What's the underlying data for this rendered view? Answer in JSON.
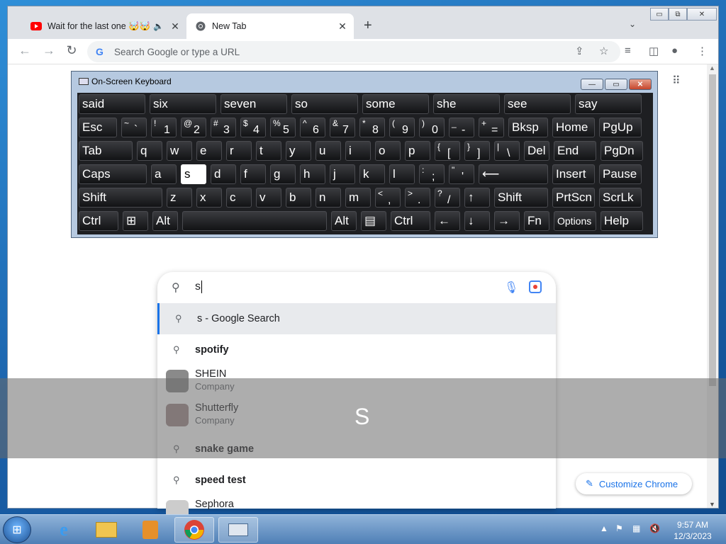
{
  "browser": {
    "tabs": [
      {
        "label": "Wait for the last one 🤯🤯 #sh",
        "icon": "youtube-icon",
        "audio": "🔈"
      },
      {
        "label": "New Tab",
        "icon": "chrome-icon"
      }
    ],
    "close_glyph": "✕",
    "new_tab_glyph": "+",
    "tab_search_glyph": "⌄",
    "window_controls": [
      "▭",
      "⧉",
      "✕"
    ],
    "omnibox_placeholder": "Search Google or type a URL",
    "google_letter": "G"
  },
  "osk": {
    "title": "On-Screen Keyboard",
    "controls": [
      "—",
      "▭",
      "✕"
    ],
    "pressed_key": "s",
    "rows": [
      [
        {
          "t": "said",
          "w": 96
        },
        {
          "t": "six",
          "w": 96
        },
        {
          "t": "seven",
          "w": 96
        },
        {
          "t": "so",
          "w": 96
        },
        {
          "t": "some",
          "w": 96
        },
        {
          "t": "she",
          "w": 96
        },
        {
          "t": "see",
          "w": 96
        },
        {
          "t": "say",
          "w": 96
        }
      ],
      [
        {
          "t": "Esc",
          "w": 56
        },
        {
          "sup": "~",
          "m": "`",
          "w": 38
        },
        {
          "sup": "!",
          "m": "1",
          "w": 38
        },
        {
          "sup": "@",
          "m": "2",
          "w": 38
        },
        {
          "sup": "#",
          "m": "3",
          "w": 38
        },
        {
          "sup": "$",
          "m": "4",
          "w": 38
        },
        {
          "sup": "%",
          "m": "5",
          "w": 38
        },
        {
          "sup": "^",
          "m": "6",
          "w": 38
        },
        {
          "sup": "&",
          "m": "7",
          "w": 38
        },
        {
          "sup": "*",
          "m": "8",
          "w": 38
        },
        {
          "sup": "(",
          "m": "9",
          "w": 38
        },
        {
          "sup": ")",
          "m": "0",
          "w": 38
        },
        {
          "sup": "_",
          "m": "-",
          "w": 38
        },
        {
          "sup": "+",
          "m": "=",
          "w": 38
        },
        {
          "t": "Bksp",
          "w": 58
        },
        {
          "t": "Home",
          "w": 62
        },
        {
          "t": "PgUp",
          "w": 62
        }
      ],
      [
        {
          "t": "Tab",
          "w": 78
        },
        {
          "t": "q",
          "w": 38
        },
        {
          "t": "w",
          "w": 38
        },
        {
          "t": "e",
          "w": 38
        },
        {
          "t": "r",
          "w": 38
        },
        {
          "t": "t",
          "w": 38
        },
        {
          "t": "y",
          "w": 38
        },
        {
          "t": "u",
          "w": 38
        },
        {
          "t": "i",
          "w": 38
        },
        {
          "t": "o",
          "w": 38
        },
        {
          "t": "p",
          "w": 38
        },
        {
          "sup": "{",
          "m": "[",
          "w": 38
        },
        {
          "sup": "}",
          "m": "]",
          "w": 38
        },
        {
          "sup": "|",
          "m": "\\",
          "w": 38
        },
        {
          "t": "Del",
          "w": 38
        },
        {
          "t": "End",
          "w": 62
        },
        {
          "t": "PgDn",
          "w": 62
        }
      ],
      [
        {
          "t": "Caps",
          "w": 98
        },
        {
          "t": "a",
          "w": 38
        },
        {
          "t": "s",
          "w": 38
        },
        {
          "t": "d",
          "w": 38
        },
        {
          "t": "f",
          "w": 38
        },
        {
          "t": "g",
          "w": 38
        },
        {
          "t": "h",
          "w": 38
        },
        {
          "t": "j",
          "w": 38
        },
        {
          "t": "k",
          "w": 38
        },
        {
          "t": "l",
          "w": 38
        },
        {
          "sup": ":",
          "m": ";",
          "w": 38
        },
        {
          "sup": "\"",
          "m": "'",
          "w": 38
        },
        {
          "t": "⟵",
          "w": 100
        },
        {
          "t": "Insert",
          "w": 62
        },
        {
          "t": "Pause",
          "w": 62
        }
      ],
      [
        {
          "t": "Shift",
          "w": 120
        },
        {
          "t": "z",
          "w": 38
        },
        {
          "t": "x",
          "w": 38
        },
        {
          "t": "c",
          "w": 38
        },
        {
          "t": "v",
          "w": 38
        },
        {
          "t": "b",
          "w": 38
        },
        {
          "t": "n",
          "w": 38
        },
        {
          "t": "m",
          "w": 38
        },
        {
          "sup": "<",
          "m": ",",
          "w": 38
        },
        {
          "sup": ">",
          "m": ".",
          "w": 38
        },
        {
          "sup": "?",
          "m": "/",
          "w": 38
        },
        {
          "t": "↑",
          "w": 38
        },
        {
          "t": "Shift",
          "w": 78
        },
        {
          "t": "PrtScn",
          "w": 62
        },
        {
          "t": "ScrLk",
          "w": 62
        }
      ],
      [
        {
          "t": "Ctrl",
          "w": 58
        },
        {
          "t": "⊞",
          "w": 38
        },
        {
          "t": "Alt",
          "w": 38
        },
        {
          "t": " ",
          "w": 206
        },
        {
          "t": "Alt",
          "w": 38
        },
        {
          "t": "▤",
          "w": 38
        },
        {
          "t": "Ctrl",
          "w": 58
        },
        {
          "t": "←",
          "w": 38
        },
        {
          "t": "↓",
          "w": 38
        },
        {
          "t": "→",
          "w": 38
        },
        {
          "t": "Fn",
          "w": 38
        },
        {
          "t": "Options",
          "w": 62
        },
        {
          "t": "Help",
          "w": 62
        }
      ]
    ]
  },
  "search": {
    "value": "s",
    "suggestions": [
      {
        "text": "s - Google Search",
        "kind": "query",
        "selected": true
      },
      {
        "text": "spotify",
        "kind": "query"
      },
      {
        "text": "SHEIN",
        "sub": "Company",
        "kind": "entity",
        "color": "#8a8a8a"
      },
      {
        "text": "Shutterfly",
        "sub": "Company",
        "kind": "entity",
        "color": "#9f8a8a"
      },
      {
        "text": "snake game",
        "kind": "query"
      },
      {
        "text": "speed test",
        "kind": "query"
      },
      {
        "text": "Sephora",
        "kind": "entity",
        "color": "#cccccc"
      }
    ]
  },
  "customize_label": "Customize Chrome",
  "overlay_char": "S",
  "taskbar": {
    "time": "9:57 AM",
    "date": "12/3/2023"
  }
}
